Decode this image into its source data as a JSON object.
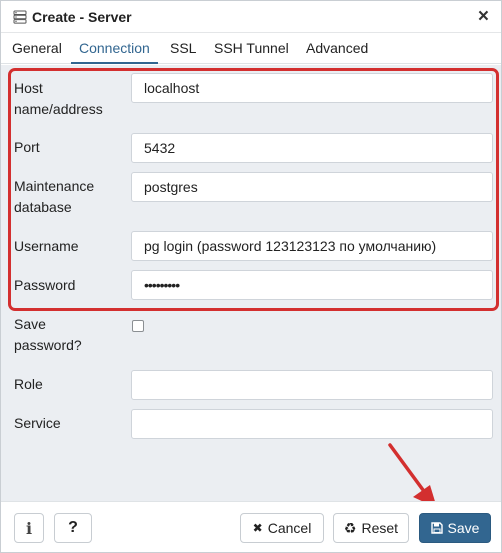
{
  "window": {
    "title": "Create - Server",
    "title_icon": "server-icon",
    "close_glyph": "×"
  },
  "tabs": [
    {
      "label": "General",
      "active": false
    },
    {
      "label": "Connection",
      "active": true
    },
    {
      "label": "SSL",
      "active": false
    },
    {
      "label": "SSH Tunnel",
      "active": false
    },
    {
      "label": "Advanced",
      "active": false
    }
  ],
  "form": {
    "host": {
      "label_line1": "Host",
      "label_line2": "name/address",
      "value": "localhost"
    },
    "port": {
      "label": "Port",
      "value": "5432"
    },
    "maintenance_db": {
      "label_line1": "Maintenance",
      "label_line2": "database",
      "value": "postgres"
    },
    "username": {
      "label": "Username",
      "value": "pg login (password 123123123 по умолчанию)"
    },
    "password": {
      "label": "Password",
      "value": "•••••••••"
    },
    "save_password": {
      "label_line1": "Save",
      "label_line2": "password?",
      "checked": false
    },
    "role": {
      "label": "Role",
      "value": ""
    },
    "service": {
      "label": "Service",
      "value": ""
    }
  },
  "footer": {
    "info_glyph": "i",
    "help_glyph": "?",
    "cancel_label": "Cancel",
    "cancel_glyph": "✖",
    "reset_label": "Reset",
    "reset_glyph": "♻",
    "save_label": "Save",
    "save_icon": "floppy-disk-icon"
  },
  "colors": {
    "accent": "#326690",
    "highlight": "#d32f2f",
    "panel_bg": "#ebeef2"
  }
}
